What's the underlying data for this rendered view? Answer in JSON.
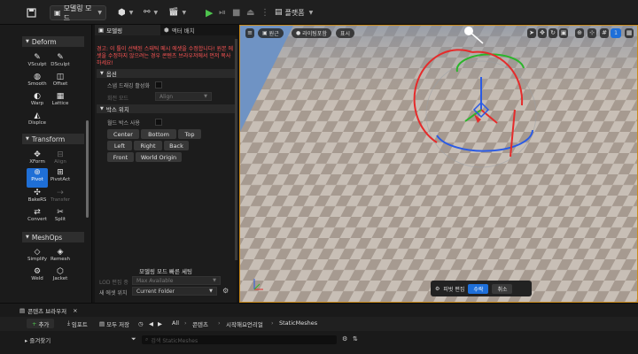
{
  "toolbar": {
    "mode_label": "모델링 모드",
    "platforms_label": "플랫폼"
  },
  "palette": {
    "sections": [
      {
        "header": "Deform",
        "tools": [
          "VSculpt",
          "DSculpt",
          "Smooth",
          "Offset",
          "Warp",
          "Lattice",
          "Displce"
        ]
      },
      {
        "header": "Transform",
        "tools": [
          "XForm",
          "Align",
          "Pivot",
          "PivotAct",
          "BakeRS",
          "Transfer",
          "Convert",
          "Split"
        ]
      },
      {
        "header": "MeshOps",
        "tools": [
          "Simplify",
          "Remesh",
          "Weld",
          "Jacket"
        ]
      }
    ],
    "active_tool": "Pivot",
    "disabled_tools": [
      "Align",
      "Transfer"
    ]
  },
  "panel": {
    "tabs": [
      "모델링",
      "액터 배치"
    ],
    "warning": "경고: 이 툴이 선택된 스태틱 메시 에셋을 수정합니다! 원본 에셋을 수정하지 않으려는 경우 콘텐츠 브라우저에서 먼저 복사하세요!",
    "options_header": "옵션",
    "snap_label": "스냅 드래깅 활성화",
    "rotation_mode_label": "회전 모드",
    "rotation_mode_value": "Align",
    "box_position_header": "박스 위치",
    "world_box_label": "월드 박스 사용",
    "buttons": [
      "Center",
      "Bottom",
      "Top",
      "Left",
      "Right",
      "Back",
      "Front",
      "World Origin"
    ],
    "quick_settings_header": "모델링 모드 빠른 세팅",
    "lod_label": "LOD 편집 중",
    "lod_value": "Max Available",
    "new_asset_label": "새 에셋 위치",
    "new_asset_value": "Current Folder"
  },
  "viewport": {
    "perspective_label": "원근",
    "lit_label": "라이팅포함",
    "show_label": "표시",
    "grid_value": "10",
    "angle_value": "10°",
    "scale_value": "0.25",
    "camera_speed": "1",
    "pivot_edit_label": "피벗 편집",
    "accept_label": "수락",
    "cancel_label": "취소",
    "colors": {
      "floor_light": "#c8bfb6",
      "floor_dark": "#a69a90",
      "sky": "#6f93c4",
      "gizmo_x": "#e52b2b",
      "gizmo_y": "#2bb52b",
      "gizmo_z": "#2b5be5"
    }
  },
  "content_browser": {
    "tab_label": "콘텐츠 브라우저",
    "add_label": "추가",
    "import_label": "임포트",
    "save_all_label": "모두 저장",
    "breadcrumb": [
      "All",
      "콘텐츠",
      "시작해요언리얼",
      "StaticMeshes"
    ],
    "favorites_label": "즐겨찾기",
    "search_placeholder": "검색 StaticMeshes"
  }
}
